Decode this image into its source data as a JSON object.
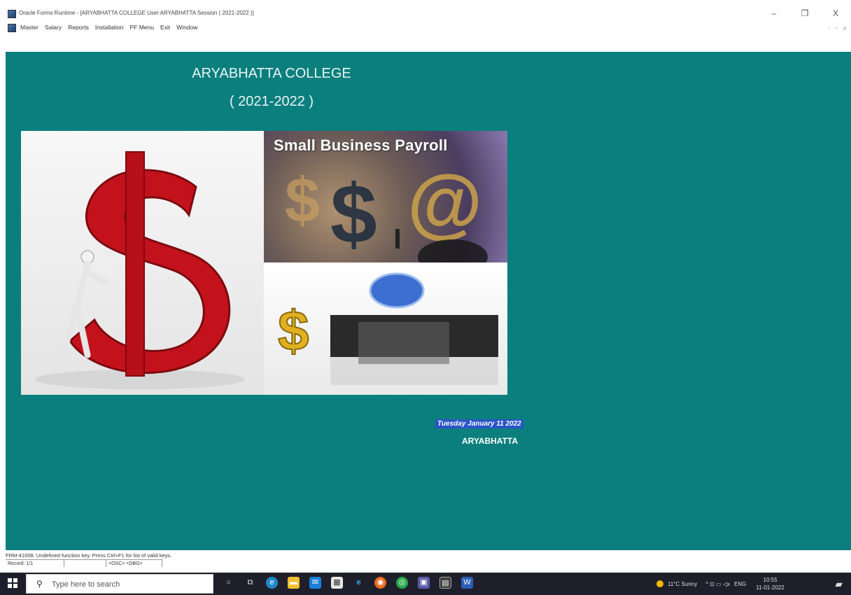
{
  "window": {
    "title": "Oracle Forms Runtime - [ARYABHATTA COLLEGE User ARYABHATTA Session ( 2021-2022 )]",
    "minimize": "–",
    "restore": "❐",
    "close": "X",
    "mdi_controls": "- ▫ x"
  },
  "menu": [
    "Master",
    "Salary",
    "Reports",
    "Installation",
    "PF Menu",
    "Exit",
    "Window"
  ],
  "canvas": {
    "college_name": "ARYABHATTA COLLEGE",
    "session_year": "( 2021-2022 )",
    "banner_title": "Small Business Payroll",
    "date": "Tuesday January 11 2022",
    "user": "ARYABHATTA"
  },
  "status": {
    "message": "FRM-41008: Undefined function key. Press Ctrl+F1 for list of valid keys.",
    "record": "Record: 1/1",
    "osc": "<OSC> <DBG>"
  },
  "taskbar": {
    "search_placeholder": "Type here to search",
    "weather": "11°C Sunny",
    "tray_icons": "^ ⊡ ▭ ◁x",
    "language": "ENG",
    "time": "10:55",
    "date": "11-01-2022"
  },
  "colors": {
    "canvas": "#0b7f7d",
    "date_highlight": "#2a55c7",
    "taskbar": "#1f1f2b"
  }
}
